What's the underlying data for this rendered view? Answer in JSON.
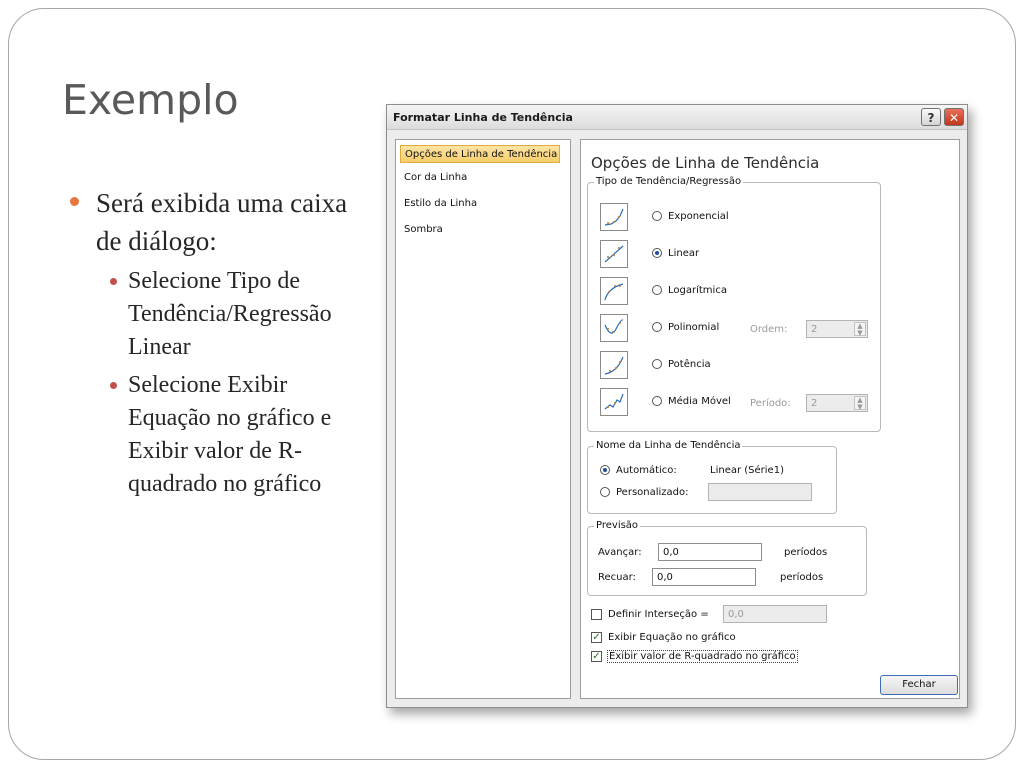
{
  "slide": {
    "title": "Exemplo",
    "bullet1": "Será exibida uma caixa de diálogo:",
    "sub1": "Selecione Tipo de Tendência/Regressão Linear",
    "sub2": "Selecione Exibir Equação no gráfico e Exibir valor de R-quadrado no gráfico"
  },
  "dialog": {
    "title": "Formatar Linha de Tendência",
    "help_label": "?",
    "close_label": "✕",
    "nav": [
      "Opções de Linha de Tendência",
      "Cor da Linha",
      "Estilo da Linha",
      "Sombra"
    ],
    "panel_title": "Opções de Linha de Tendência",
    "type_group": "Tipo de Tendência/Regressão",
    "types": [
      "Exponencial",
      "Linear",
      "Logarítmica",
      "Polinomial",
      "Potência",
      "Média Móvel"
    ],
    "selected_type": "Linear",
    "order_label": "Ordem:",
    "order_value": "2",
    "period_label": "Período:",
    "period_value": "2",
    "name_group": "Nome da Linha de Tendência",
    "auto_label": "Automático:",
    "auto_value": "Linear (Série1)",
    "custom_label": "Personalizado:",
    "forecast_group": "Previsão",
    "forward_label": "Avançar:",
    "forward_value": "0,0",
    "backward_label": "Recuar:",
    "backward_value": "0,0",
    "periods_label": "períodos",
    "intercept_label": "Definir Interseção =",
    "intercept_value": "0,0",
    "show_equation": "Exibir Equação no gráfico",
    "show_r2": "Exibir valor de R-quadrado no gráfico",
    "close_button": "Fechar"
  },
  "colors": {
    "bullet": "#e7763c",
    "sub_bullet": "#c0504d",
    "selected_nav": "#f8cd6c"
  }
}
